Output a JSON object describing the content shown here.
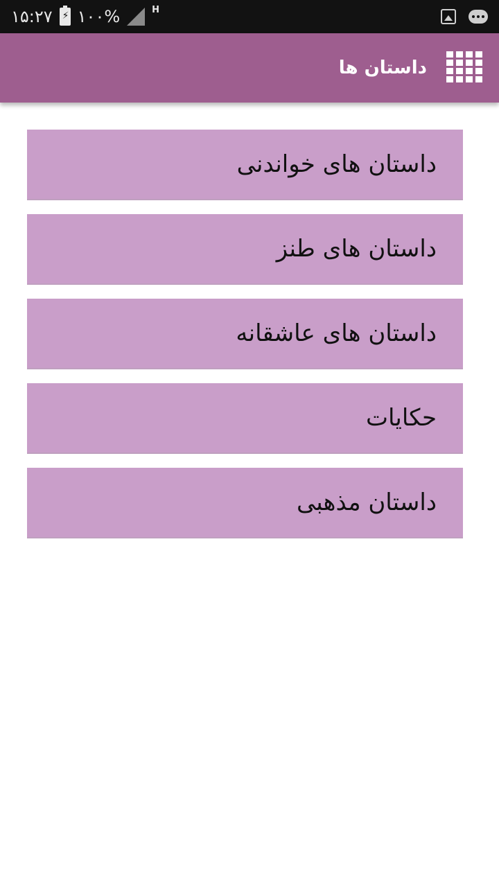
{
  "status_bar": {
    "time": "۱۵:۲۷",
    "battery_percent": "۱۰۰%",
    "network_type": "H",
    "icons": [
      "battery-charging-icon",
      "signal-icon",
      "image-notification-icon",
      "message-notification-icon"
    ]
  },
  "app_bar": {
    "title": "داستان ها",
    "menu_icon": "grid-menu-icon",
    "color": "#9e5e8f"
  },
  "menu": {
    "item_color": "#c99ec9",
    "items": [
      {
        "label": "داستان های خواندنی"
      },
      {
        "label": "داستان های طنز"
      },
      {
        "label": "داستان های عاشقانه"
      },
      {
        "label": "حکایات"
      },
      {
        "label": "داستان مذهبی"
      }
    ]
  }
}
